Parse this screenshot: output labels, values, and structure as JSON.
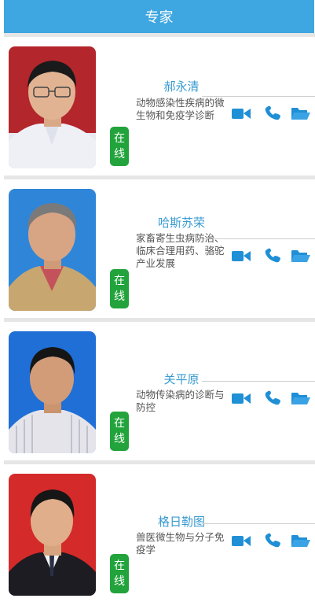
{
  "header": {
    "title": "专家"
  },
  "colors": {
    "header": "#3ea6e0",
    "name": "#3a9bd1",
    "status": "#22a33c",
    "icon": "#1f8fd6"
  },
  "experts": [
    {
      "name": "郝永清",
      "description": "动物感染性疾病的微生物和免疫学诊断",
      "status": "在线"
    },
    {
      "name": "哈斯苏荣",
      "description": "家畜寄生虫病防治、临床合理用药、骆驼产业发展",
      "status": "在线"
    },
    {
      "name": "关平原",
      "description": "动物传染病的诊断与防控",
      "status": "在线"
    },
    {
      "name": "格日勒图",
      "description": "兽医微生物与分子免疫学",
      "status": "在线"
    }
  ],
  "actions": {
    "video": "video-camera-icon",
    "phone": "phone-icon",
    "folder": "folder-icon"
  }
}
